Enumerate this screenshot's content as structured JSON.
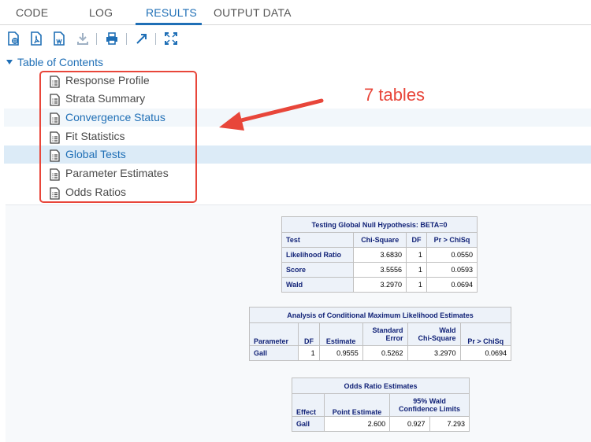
{
  "tabs": [
    "CODE",
    "LOG",
    "RESULTS",
    "OUTPUT DATA"
  ],
  "active_tab": "RESULTS",
  "toc": {
    "header": "Table of Contents",
    "items": [
      {
        "label": "Response Profile"
      },
      {
        "label": "Strata Summary"
      },
      {
        "label": "Convergence Status"
      },
      {
        "label": "Fit Statistics"
      },
      {
        "label": "Global Tests"
      },
      {
        "label": "Parameter Estimates"
      },
      {
        "label": "Odds Ratios"
      }
    ]
  },
  "annotation": "7 tables",
  "colors": {
    "accent": "#1f6fb6",
    "annotation_red": "#e8463a",
    "table_text": "#112277"
  },
  "toolbar_icons": [
    "html-doc-icon",
    "pdf-doc-icon",
    "word-doc-icon",
    "download-icon",
    "print-icon",
    "expand-arrow-icon",
    "fullscreen-icon"
  ],
  "global_tests": {
    "title": "Testing Global Null Hypothesis: BETA=0",
    "headers": [
      "Test",
      "Chi-Square",
      "DF",
      "Pr > ChiSq"
    ],
    "rows": [
      [
        "Likelihood Ratio",
        "3.6830",
        "1",
        "0.0550"
      ],
      [
        "Score",
        "3.5556",
        "1",
        "0.0593"
      ],
      [
        "Wald",
        "3.2970",
        "1",
        "0.0694"
      ]
    ]
  },
  "estimates": {
    "title": "Analysis of Conditional Maximum Likelihood Estimates",
    "headers": [
      "Parameter",
      "DF",
      "Estimate",
      "Standard Error",
      "Wald Chi-Square",
      "Pr > ChiSq"
    ],
    "header_line1": [
      "",
      "",
      "",
      "Standard",
      "Wald",
      ""
    ],
    "header_line2": [
      "Parameter",
      "DF",
      "Estimate",
      "Error",
      "Chi-Square",
      "Pr > ChiSq"
    ],
    "rows": [
      [
        "Gall",
        "1",
        "0.9555",
        "0.5262",
        "3.2970",
        "0.0694"
      ]
    ]
  },
  "odds": {
    "title": "Odds Ratio Estimates",
    "h_effect": "Effect",
    "h_point": "Point Estimate",
    "h_ci_1": "95% Wald",
    "h_ci_2": "Confidence Limits",
    "rows": [
      [
        "Gall",
        "2.600",
        "0.927",
        "7.293"
      ]
    ]
  }
}
